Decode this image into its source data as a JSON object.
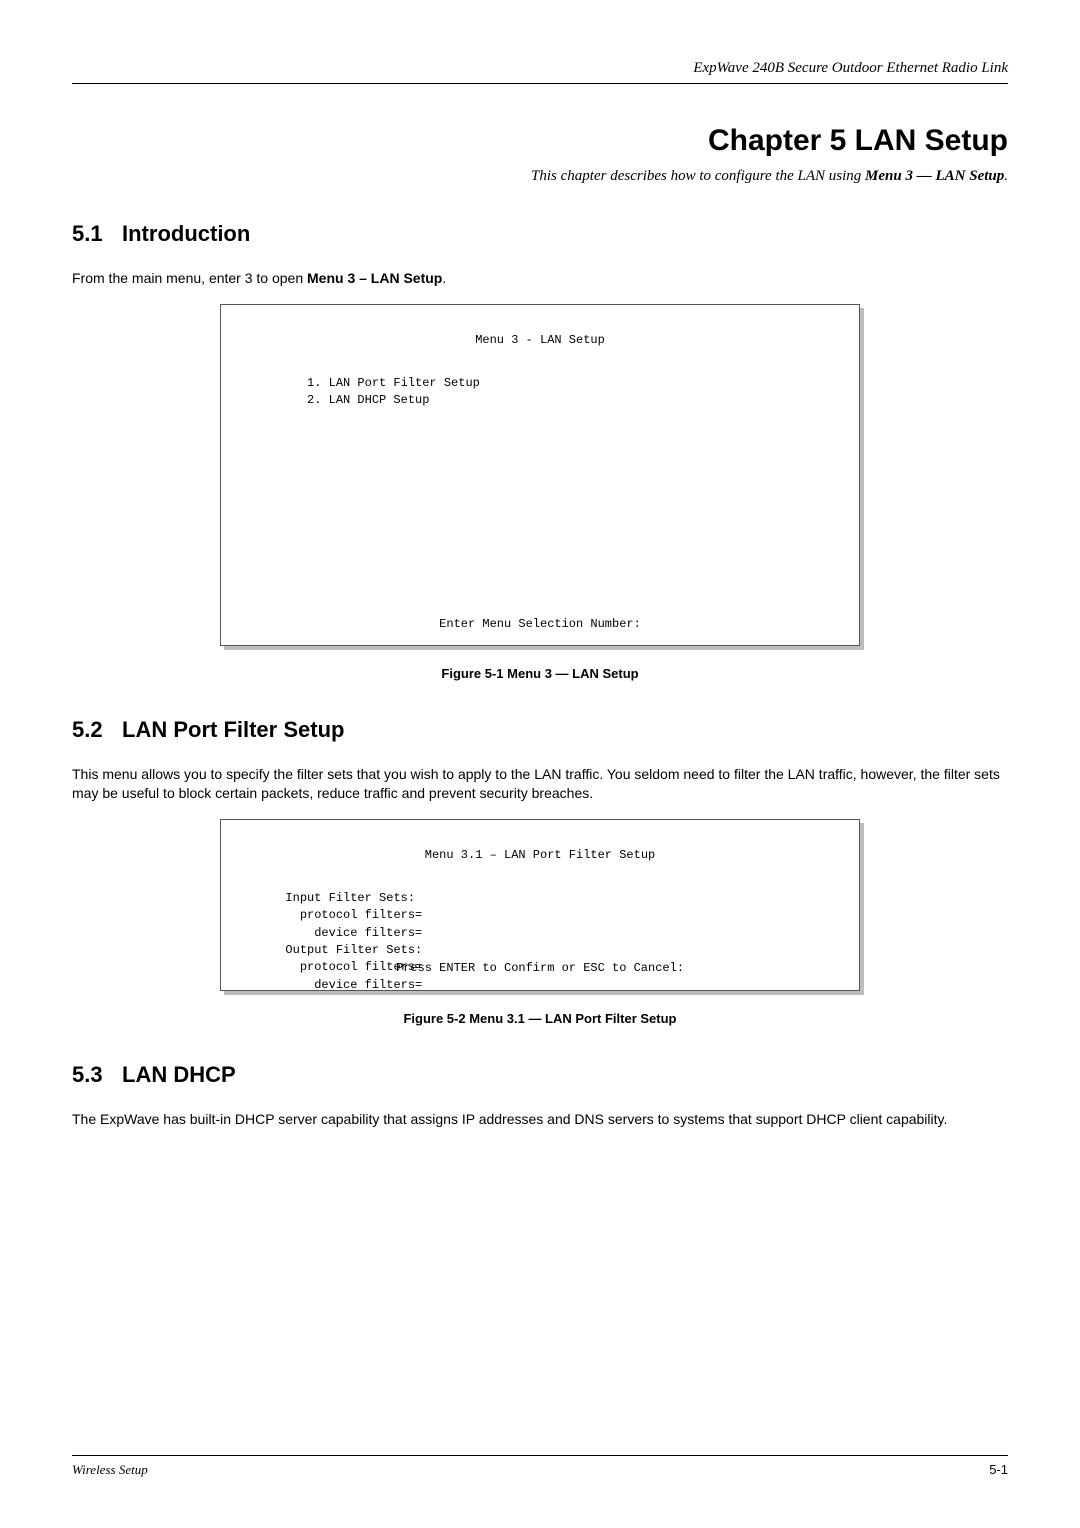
{
  "running_header": "ExpWave 240B Secure Outdoor Ethernet Radio Link",
  "chapter_title": "Chapter 5  LAN Setup",
  "chapter_subtitle_pre": "This chapter describes how to configure the LAN using ",
  "chapter_subtitle_bold": "Menu 3 — LAN Setup",
  "chapter_subtitle_post": ".",
  "sec51_num": "5.1",
  "sec51_title": "Introduction",
  "sec51_p_pre": "From the main menu, enter 3 to open ",
  "sec51_p_bold": "Menu 3 – LAN Setup",
  "sec51_p_post": ".",
  "term1_title": "Menu 3 - LAN Setup",
  "term1_line1": "1. LAN Port Filter Setup",
  "term1_line2": "2. LAN DHCP Setup",
  "term1_footer": "Enter Menu Selection Number:",
  "fig1_caption": "Figure 5-1 Menu 3 — LAN Setup",
  "sec52_num": "5.2",
  "sec52_title": "LAN Port Filter Setup",
  "sec52_p": "This menu allows you to specify the filter sets that you wish to apply to the LAN traffic. You seldom need to filter the LAN traffic, however, the filter sets may be useful to block certain packets, reduce traffic and prevent security breaches.",
  "term2_title": "Menu 3.1 – LAN Port Filter Setup",
  "term2_l1": "Input Filter Sets:",
  "term2_l2": "  protocol filters=",
  "term2_l3": "    device filters=",
  "term2_l4": "Output Filter Sets:",
  "term2_l5": "  protocol filters=",
  "term2_l6": "    device filters=",
  "term2_footer": "Press ENTER to Confirm or ESC to Cancel:",
  "fig2_caption": "Figure 5-2 Menu 3.1 — LAN Port Filter Setup",
  "sec53_num": "5.3",
  "sec53_title": "LAN DHCP",
  "sec53_p": "The ExpWave has built-in DHCP server capability that assigns IP addresses and DNS servers to systems that support DHCP client capability.",
  "footer_title": "Wireless Setup",
  "footer_page": "5-1"
}
